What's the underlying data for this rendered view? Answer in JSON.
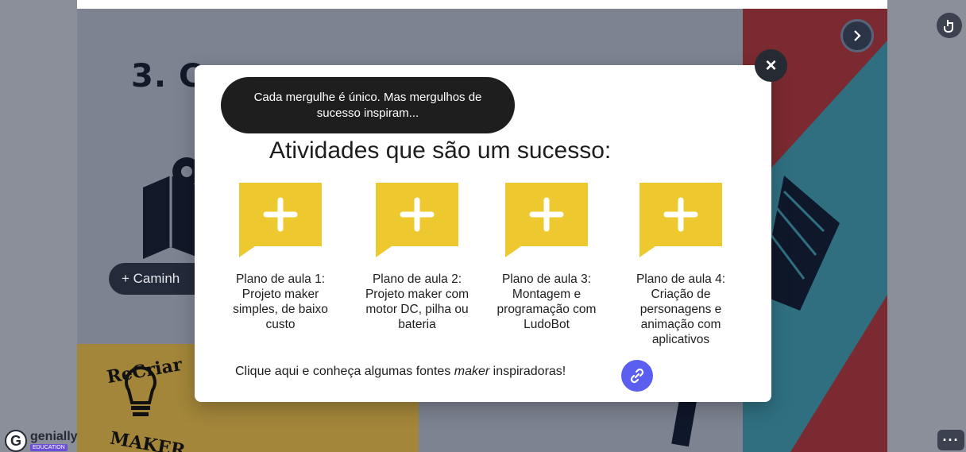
{
  "background": {
    "title": "3. C",
    "pill_label": "+ Caminh",
    "logo": {
      "top": "ReCriar",
      "bottom": "MAKER"
    }
  },
  "modal": {
    "bubble_text": "Cada mergulhe é único. Mas mergulhos de sucesso inspiram...",
    "heading": "Atividades que são um sucesso:",
    "cards": [
      {
        "label": "Plano de aula 1: Projeto maker simples, de baixo custo"
      },
      {
        "label": "Plano de aula 2: Projeto maker com motor DC, pilha ou bateria"
      },
      {
        "label": "Plano de aula 3: Montagem e programação com LudoBot"
      },
      {
        "label": "Plano de aula 4: Criação de personagens e animação com aplicativos"
      }
    ],
    "footer": {
      "before": "Clique aqui e conheça algumas fontes ",
      "em": "maker",
      "after": " inspiradoras!"
    },
    "close_icon": "close-icon",
    "link_icon": "link-icon"
  },
  "branding": {
    "name": "genially",
    "sub": "EDUCATION"
  },
  "colors": {
    "accent_yellow": "#edc92f",
    "link_button": "#5b5ff0",
    "bubble": "#1e1e1e"
  }
}
